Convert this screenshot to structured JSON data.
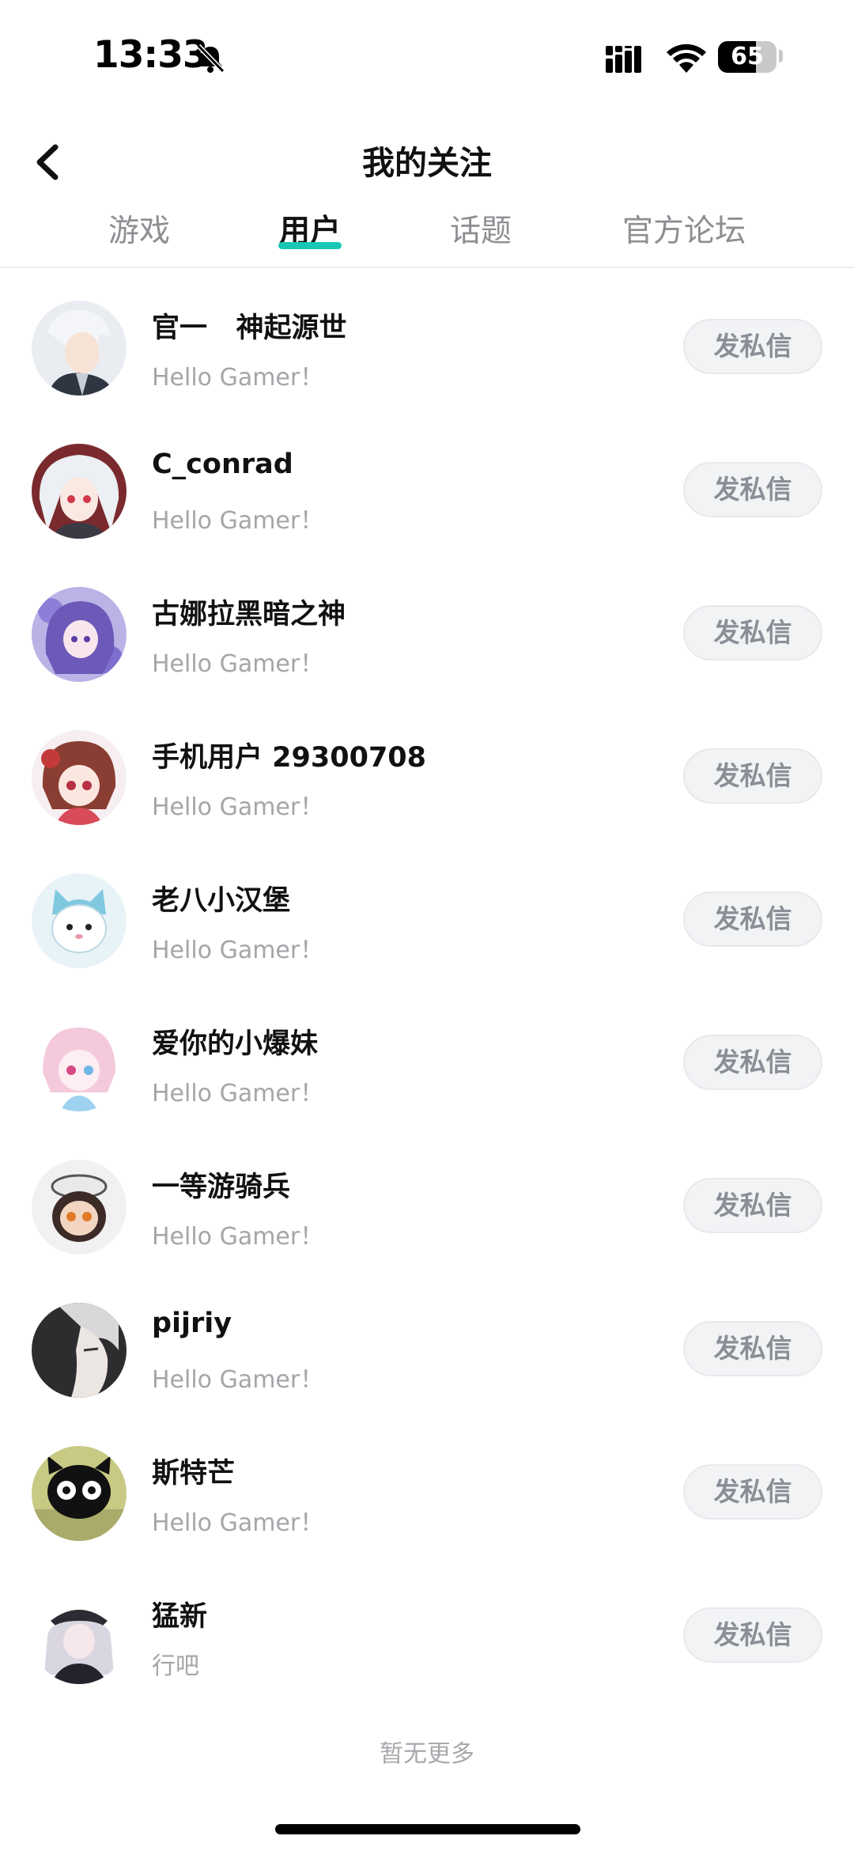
{
  "status_bar": {
    "time": "13:33",
    "battery_text": "65",
    "battery_level": 0.65,
    "icons": [
      "bell-off-icon",
      "signal-icon",
      "wifi-icon",
      "battery-icon"
    ]
  },
  "header": {
    "title": "我的关注",
    "back_icon": "chevron-left-icon"
  },
  "tabs": [
    {
      "label": "游戏",
      "active": false
    },
    {
      "label": "用户",
      "active": true
    },
    {
      "label": "话题",
      "active": false
    },
    {
      "label": "官方论坛",
      "active": false
    }
  ],
  "colors": {
    "accent": "#18c7b4",
    "button_bg": "#f2f3f5",
    "button_text": "#8b8e96",
    "secondary_text": "#a5a5aa"
  },
  "users": [
    {
      "name": "官一   神起源世",
      "bio": "Hello Gamer！",
      "button": "发私信",
      "avatar": "white-hair-boy"
    },
    {
      "name": "C_conrad",
      "bio": "Hello Gamer！",
      "button": "发私信",
      "avatar": "white-hair-girl"
    },
    {
      "name": "古娜拉黑暗之神",
      "bio": "Hello Gamer！",
      "button": "发私信",
      "avatar": "purple-hair-girl"
    },
    {
      "name": "手机用户 29300708",
      "bio": "Hello Gamer！",
      "button": "发私信",
      "avatar": "brown-hair-girl"
    },
    {
      "name": "老八小汉堡",
      "bio": "Hello Gamer！",
      "button": "发私信",
      "avatar": "cat-hat-character"
    },
    {
      "name": "爱你的小爆妹",
      "bio": "Hello Gamer！",
      "button": "发私信",
      "avatar": "pink-hair-girl"
    },
    {
      "name": "一等游骑兵",
      "bio": "Hello Gamer！",
      "button": "发私信",
      "avatar": "chibi-ranger"
    },
    {
      "name": "pijriy",
      "bio": "Hello Gamer！",
      "button": "发私信",
      "avatar": "grey-hair-profile"
    },
    {
      "name": "斯特芒",
      "bio": "Hello Gamer！",
      "button": "发私信",
      "avatar": "black-cat"
    },
    {
      "name": "猛新",
      "bio": "行吧",
      "button": "发私信",
      "avatar": "officer-girl"
    }
  ],
  "footer": {
    "end_text": "暂无更多"
  }
}
